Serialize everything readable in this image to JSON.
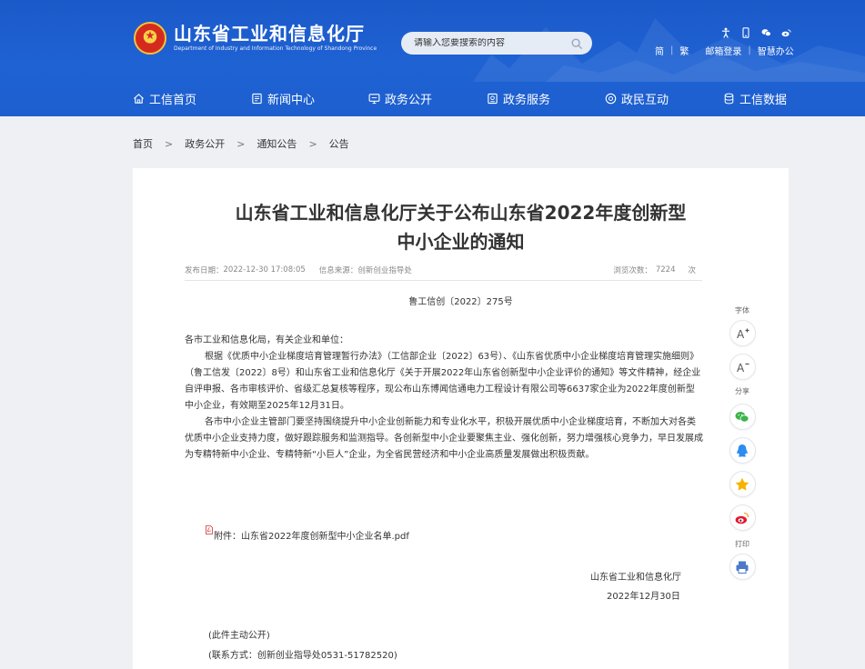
{
  "header": {
    "site_title": "山东省工业和信息化厅",
    "site_subtitle": "Department of Industry and Information Technology of Shandong Province",
    "search_placeholder": "请输入您要搜索的内容",
    "links": {
      "simplified": "简",
      "traditional": "繁",
      "email_login": "邮箱登录",
      "smart_office": "智慧办公"
    },
    "top_icons": [
      "accessibility-icon",
      "mobile-icon",
      "wechat-icon",
      "weibo-icon"
    ]
  },
  "nav": {
    "items": [
      {
        "label": "工信首页",
        "icon": "home-icon"
      },
      {
        "label": "新闻中心",
        "icon": "news-icon"
      },
      {
        "label": "政务公开",
        "icon": "monitor-icon"
      },
      {
        "label": "政务服务",
        "icon": "service-icon"
      },
      {
        "label": "政民互动",
        "icon": "interact-icon"
      },
      {
        "label": "工信数据",
        "icon": "database-icon"
      }
    ]
  },
  "breadcrumb": {
    "items": [
      "首页",
      "政务公开",
      "通知公告",
      "公告"
    ],
    "separator": ">"
  },
  "article": {
    "title_line1": "山东省工业和信息化厅关于公布山东省2022年度创新型",
    "title_line2": "中小企业的通知",
    "meta": {
      "publish_label": "发布日期：",
      "publish_date": "2022-12-30 17:08:05",
      "source_label": "信息来源：",
      "source": "创新创业指导处",
      "views_label": "浏览次数：",
      "views": "7224",
      "views_unit": "次"
    },
    "doc_number": "鲁工信创〔2022〕275号",
    "salutation": "各市工业和信息化局，有关企业和单位：",
    "paragraph1": "根据《优质中小企业梯度培育管理暂行办法》（工信部企业〔2022〕63号）、《山东省优质中小企业梯度培育管理实施细则》（鲁工信发〔2022〕8号）和山东省工业和信息化厅《关于开展2022年山东省创新型中小企业评价的通知》等文件精神，经企业自评申报、各市审核评价、省级汇总复核等程序，现公布山东博闻信通电力工程设计有限公司等6637家企业为2022年度创新型中小企业，有效期至2025年12月31日。",
    "paragraph2": "各市中小企业主管部门要坚持围绕提升中小企业创新能力和专业化水平，积极开展优质中小企业梯度培育，不断加大对各类优质中小企业支持力度，做好跟踪服务和监测指导。各创新型中小企业要聚焦主业、强化创新，努力增强核心竞争力，早日发展成为专精特新中小企业、专精特新“小巨人”企业，为全省民营经济和中小企业高质量发展做出积极贡献。",
    "attachment": "附件：山东省2022年度创新型中小企业名单.pdf",
    "sign_org": "山东省工业和信息化厅",
    "sign_date": "2022年12月30日",
    "note_public": "(此件主动公开)",
    "note_contact": "(联系方式：创新创业指导处0531-51782520)"
  },
  "sidebar": {
    "font_label": "字体",
    "share_label": "分享",
    "print_label": "打印",
    "font_increase_icon": "font-increase-icon",
    "font_decrease_icon": "font-decrease-icon",
    "share_icons": [
      "wechat-icon",
      "qq-icon",
      "qzone-icon",
      "weibo-icon"
    ],
    "print_icon": "printer-icon"
  },
  "colors": {
    "header_blue": "#1d5fcf",
    "page_background": "#eef0f4",
    "wechat_green": "#3bb44a",
    "qq_blue": "#2d8cf0",
    "qzone_yellow": "#f5b400",
    "weibo_red": "#e6162d"
  }
}
